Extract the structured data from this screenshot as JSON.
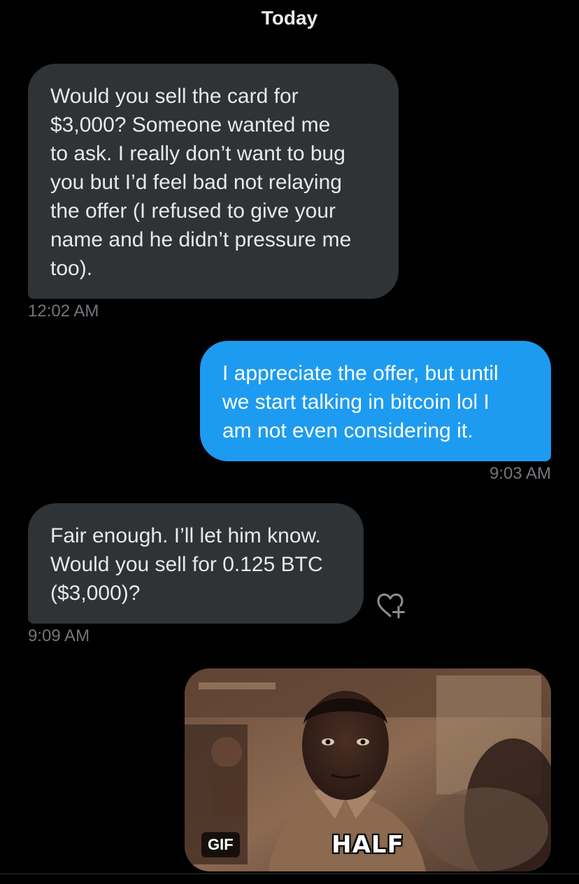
{
  "conversation": {
    "day_header": "Today",
    "messages": [
      {
        "direction": "received",
        "text": "Would you sell the card for\n$3,000? Someone wanted me\nto ask. I really don’t want to bug\nyou but I’d feel bad not relaying\nthe offer (I refused to give your\nname and he didn’t pressure me\ntoo).",
        "time": "12:02 AM"
      },
      {
        "direction": "sent",
        "text": "I appreciate the offer, but until\nwe start talking in bitcoin lol I\nam not even considering it.",
        "time": "9:03 AM"
      },
      {
        "direction": "received",
        "text": "Fair enough. I’ll let him know.\nWould you sell for 0.125 BTC\n($3,000)?",
        "time": "9:09 AM",
        "reaction_icon": "heart-plus-icon"
      }
    ],
    "gif": {
      "badge": "GIF",
      "caption": "HALF"
    }
  },
  "colors": {
    "background": "#000000",
    "received_bubble": "#2f3336",
    "sent_bubble": "#1d9bf0",
    "timestamp": "#71767b"
  }
}
